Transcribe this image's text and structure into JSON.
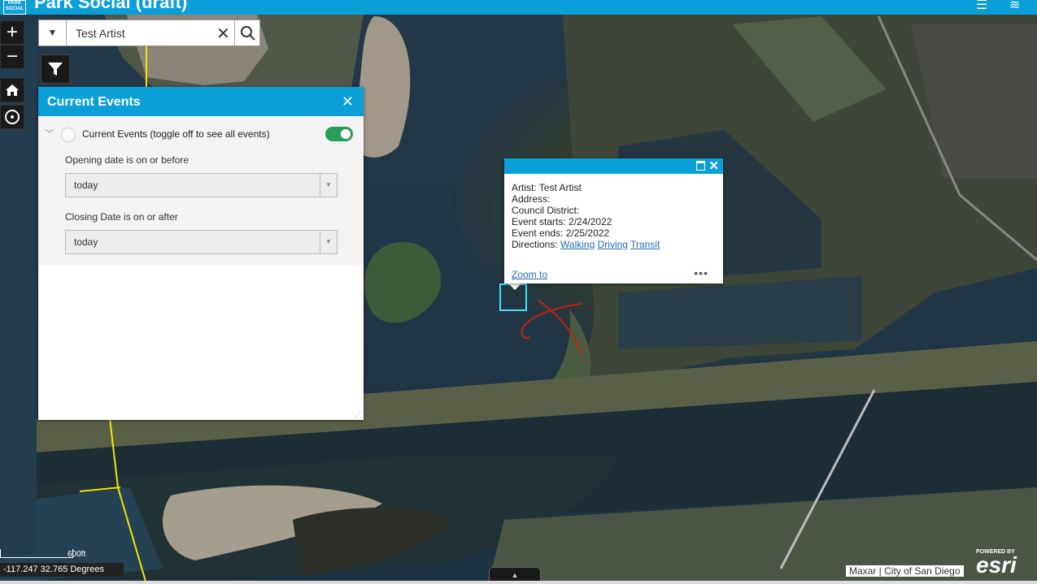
{
  "app": {
    "title": "Park Social (draft)",
    "logo_text": "PARK SOCIAL"
  },
  "toolbar": {
    "zoom_in": "+",
    "zoom_out": "−"
  },
  "search": {
    "value": "Test Artist",
    "clear": "✕"
  },
  "panel": {
    "title": "Current Events",
    "close": "✕",
    "toggle_label": "Current Events (toggle off to see all events)",
    "toggle_on": true,
    "opening_label": "Opening date is on or before",
    "opening_value": "today",
    "closing_label": "Closing Date is on or after",
    "closing_value": "today"
  },
  "popup": {
    "artist_label": "Artist:",
    "artist_value": "Test Artist",
    "address_label": "Address:",
    "district_label": "Council District:",
    "starts_label": "Event starts:",
    "starts_value": "2/24/2022",
    "ends_label": "Event ends:",
    "ends_value": "2/25/2022",
    "directions_label": "Directions:",
    "link_walking": "Walking",
    "link_driving": "Driving",
    "link_transit": "Transit",
    "zoom_to": "Zoom to",
    "more": "•••"
  },
  "map": {
    "scale_text": "600ft",
    "coords": "-117.247 32.765 Degrees",
    "attribution": "Maxar | City of San Diego",
    "powered_by": "POWERED BY",
    "esri": "esri"
  },
  "colors": {
    "header": "#0b9fd8",
    "toggle": "#2a9d58",
    "highlight": "#3fe0ff"
  }
}
